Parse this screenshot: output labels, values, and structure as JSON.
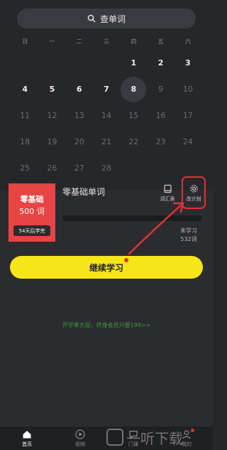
{
  "search": {
    "label": "查单词"
  },
  "calendar": {
    "weekdays": [
      "日",
      "一",
      "二",
      "三",
      "四",
      "五",
      "六"
    ],
    "days": [
      {
        "d": "",
        "state": "empty"
      },
      {
        "d": "",
        "state": "empty"
      },
      {
        "d": "",
        "state": "empty"
      },
      {
        "d": "",
        "state": "empty"
      },
      {
        "d": "1",
        "state": "past"
      },
      {
        "d": "2",
        "state": "past"
      },
      {
        "d": "3",
        "state": "past"
      },
      {
        "d": "4",
        "state": "past"
      },
      {
        "d": "5",
        "state": "past"
      },
      {
        "d": "6",
        "state": "past"
      },
      {
        "d": "7",
        "state": "past"
      },
      {
        "d": "8",
        "state": "today"
      },
      {
        "d": "9",
        "state": "future"
      },
      {
        "d": "10",
        "state": "future"
      },
      {
        "d": "11",
        "state": "future"
      },
      {
        "d": "12",
        "state": "future"
      },
      {
        "d": "13",
        "state": "future"
      },
      {
        "d": "14",
        "state": "future"
      },
      {
        "d": "15",
        "state": "future"
      },
      {
        "d": "16",
        "state": "future"
      },
      {
        "d": "17",
        "state": "future"
      },
      {
        "d": "18",
        "state": "future"
      },
      {
        "d": "19",
        "state": "future"
      },
      {
        "d": "20",
        "state": "future"
      },
      {
        "d": "21",
        "state": "future"
      },
      {
        "d": "22",
        "state": "future"
      },
      {
        "d": "23",
        "state": "future"
      },
      {
        "d": "24",
        "state": "future"
      },
      {
        "d": "25",
        "state": "future"
      },
      {
        "d": "26",
        "state": "future"
      },
      {
        "d": "27",
        "state": "future"
      },
      {
        "d": "28",
        "state": "future"
      }
    ]
  },
  "book": {
    "cover_title": "零基础",
    "cover_count": "500 词",
    "cover_badge": "54天后学完",
    "name": "零基础单词",
    "progress": 0,
    "unlearned_label": "未学习",
    "remaining": "532词"
  },
  "tools": {
    "vocab_label": "词汇表",
    "plan_label": "改计划"
  },
  "cta": {
    "label": "继续学习"
  },
  "promo": {
    "text": "开学季大促，终身会员只要199>>"
  },
  "tabs": [
    {
      "label": "首页",
      "icon": "home-icon",
      "active": true
    },
    {
      "label": "视频",
      "icon": "play-icon",
      "active": false
    },
    {
      "label": "门课",
      "icon": "chat-icon",
      "active": false
    },
    {
      "label": "我的",
      "icon": "person-icon",
      "active": false
    }
  ],
  "watermark": {
    "text": "一听下载"
  },
  "colors": {
    "accent": "#f6e519",
    "book": "#e84444",
    "highlight": "#e23232",
    "promo": "#3d9b3a",
    "background": "#26272b"
  }
}
